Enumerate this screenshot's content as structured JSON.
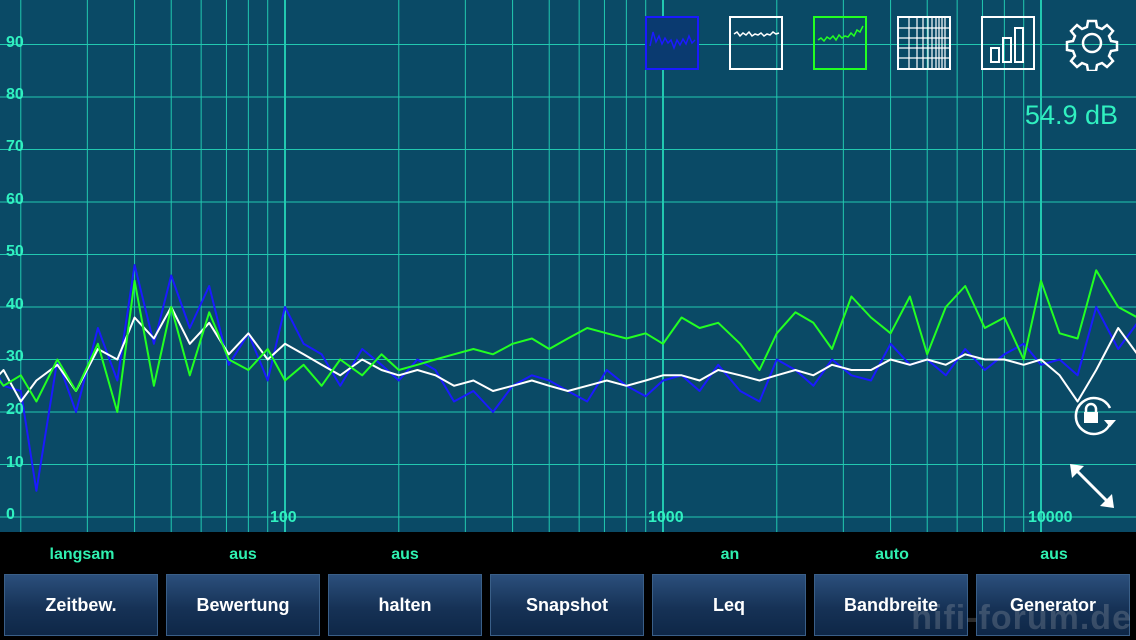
{
  "chart_data": {
    "type": "line",
    "xscale": "log",
    "xlim": [
      10,
      25000
    ],
    "ylim": [
      0,
      100
    ],
    "y_ticks": [
      "0",
      "10",
      "20",
      "30",
      "40",
      "50",
      "60",
      "70",
      "80",
      "90"
    ],
    "x_ticks": [
      "100",
      "1000",
      "10000"
    ],
    "series": [
      {
        "color": "#1a1aff",
        "x": [
          10,
          12,
          14,
          16,
          18,
          20,
          22,
          25,
          28,
          32,
          36,
          40,
          45,
          50,
          56,
          63,
          71,
          80,
          90,
          100,
          112,
          125,
          140,
          160,
          180,
          200,
          224,
          250,
          280,
          315,
          355,
          400,
          450,
          500,
          560,
          630,
          710,
          800,
          900,
          1000,
          1120,
          1250,
          1400,
          1600,
          1800,
          2000,
          2240,
          2500,
          2800,
          3150,
          3550,
          4000,
          4500,
          5000,
          5600,
          6300,
          7100,
          8000,
          9000,
          10000,
          11200,
          12500,
          14000,
          16000,
          18000,
          20000,
          22400,
          25000
        ],
        "values": [
          26,
          35,
          14,
          32,
          25,
          24,
          5,
          30,
          20,
          36,
          26,
          48,
          33,
          46,
          36,
          44,
          29,
          35,
          26,
          40,
          33,
          31,
          25,
          32,
          29,
          26,
          30,
          28,
          22,
          24,
          20,
          25,
          27,
          26,
          24,
          22,
          28,
          25,
          23,
          26,
          27,
          24,
          29,
          24,
          22,
          30,
          28,
          25,
          30,
          27,
          26,
          33,
          29,
          30,
          27,
          32,
          28,
          31,
          33,
          29,
          30,
          27,
          40,
          32,
          37,
          28,
          33,
          22
        ]
      },
      {
        "color": "#ffffff",
        "x": [
          10,
          12,
          14,
          16,
          18,
          20,
          22,
          25,
          28,
          32,
          36,
          40,
          45,
          50,
          56,
          63,
          71,
          80,
          90,
          100,
          112,
          125,
          140,
          160,
          180,
          200,
          224,
          250,
          280,
          315,
          355,
          400,
          450,
          500,
          560,
          630,
          710,
          800,
          900,
          1000,
          1120,
          1250,
          1400,
          1600,
          1800,
          2000,
          2240,
          2500,
          2800,
          3150,
          3550,
          4000,
          4500,
          5000,
          5600,
          6300,
          7100,
          8000,
          9000,
          10000,
          11200,
          12500,
          14000,
          16000,
          18000,
          20000,
          22400,
          25000
        ],
        "values": [
          24,
          34,
          27,
          24,
          28,
          22,
          26,
          29,
          24,
          32,
          30,
          38,
          34,
          40,
          33,
          37,
          31,
          35,
          30,
          33,
          31,
          29,
          27,
          30,
          28,
          27,
          28,
          27,
          25,
          26,
          24,
          25,
          26,
          25,
          24,
          25,
          26,
          25,
          26,
          27,
          27,
          26,
          28,
          27,
          26,
          27,
          28,
          27,
          29,
          28,
          28,
          30,
          29,
          30,
          29,
          31,
          30,
          30,
          29,
          30,
          27,
          22,
          28,
          36,
          31,
          33,
          31,
          26
        ]
      },
      {
        "color": "#22ff22",
        "x": [
          10,
          12,
          14,
          16,
          18,
          20,
          22,
          25,
          28,
          32,
          36,
          40,
          45,
          50,
          56,
          63,
          71,
          80,
          90,
          100,
          112,
          125,
          140,
          160,
          180,
          200,
          224,
          250,
          280,
          315,
          355,
          400,
          450,
          500,
          560,
          630,
          710,
          800,
          900,
          1000,
          1120,
          1250,
          1400,
          1600,
          1800,
          2000,
          2240,
          2500,
          2800,
          3150,
          3550,
          4000,
          4500,
          5000,
          5600,
          6300,
          7100,
          8000,
          9000,
          10000,
          11200,
          12500,
          14000,
          16000,
          18000,
          20000,
          22400,
          25000
        ],
        "values": [
          24,
          28,
          26,
          30,
          25,
          27,
          22,
          30,
          24,
          33,
          20,
          45,
          25,
          40,
          27,
          39,
          30,
          28,
          32,
          26,
          29,
          25,
          30,
          27,
          31,
          28,
          29,
          30,
          31,
          32,
          31,
          33,
          34,
          32,
          34,
          36,
          35,
          34,
          35,
          33,
          38,
          36,
          37,
          33,
          28,
          35,
          39,
          37,
          32,
          42,
          38,
          35,
          42,
          31,
          40,
          44,
          36,
          38,
          30,
          45,
          35,
          34,
          47,
          40,
          38,
          42,
          35,
          30
        ]
      }
    ]
  },
  "toolbar": {
    "icons": [
      "spectrum-blue-icon",
      "spectrum-white-icon",
      "spectrum-green-icon",
      "grid-icon",
      "bar-chart-icon",
      "gear-icon"
    ]
  },
  "readout": "54.9 dB",
  "controls": [
    {
      "state": "langsam",
      "label": "Zeitbew."
    },
    {
      "state": "aus",
      "label": "Bewertung"
    },
    {
      "state": "aus",
      "label": "halten"
    },
    {
      "state": "",
      "label": "Snapshot"
    },
    {
      "state": "an",
      "label": "Leq"
    },
    {
      "state": "auto",
      "label": "Bandbreite"
    },
    {
      "state": "aus",
      "label": "Generator"
    }
  ],
  "colors": {
    "grid": "#22c8b0",
    "background": "#0a4a66",
    "accent": "#30f0c0"
  },
  "watermark": "hifi-forum.de"
}
